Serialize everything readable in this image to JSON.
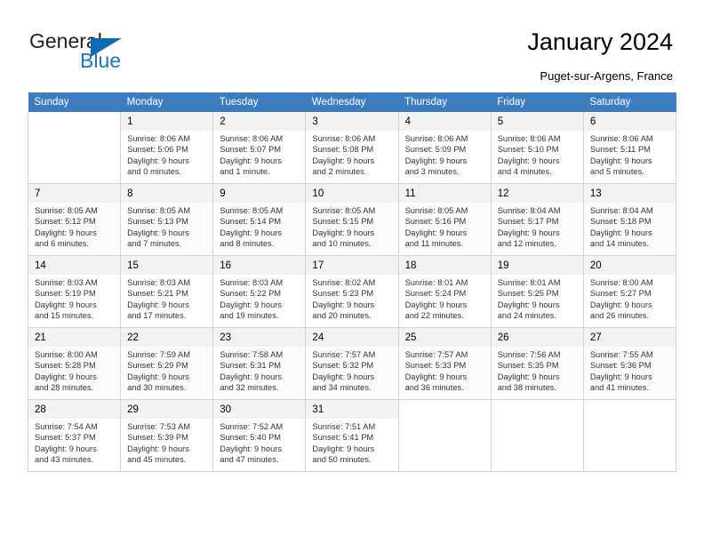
{
  "brand": {
    "name_top": "General",
    "name_bottom": "Blue",
    "accent_color": "#1b75bb",
    "triangle_color": "#0d6cb3"
  },
  "header": {
    "title": "January 2024",
    "subtitle": "Puget-sur-Argens, France"
  },
  "calendar": {
    "header_bg": "#3c7dc0",
    "header_text_color": "#ffffff",
    "weekdays": [
      "Sunday",
      "Monday",
      "Tuesday",
      "Wednesday",
      "Thursday",
      "Friday",
      "Saturday"
    ],
    "weeks": [
      [
        {
          "day": "",
          "sunrise": "",
          "sunset": "",
          "daylight_line1": "",
          "daylight_line2": ""
        },
        {
          "day": "1",
          "sunrise": "Sunrise: 8:06 AM",
          "sunset": "Sunset: 5:06 PM",
          "daylight_line1": "Daylight: 9 hours",
          "daylight_line2": "and 0 minutes."
        },
        {
          "day": "2",
          "sunrise": "Sunrise: 8:06 AM",
          "sunset": "Sunset: 5:07 PM",
          "daylight_line1": "Daylight: 9 hours",
          "daylight_line2": "and 1 minute."
        },
        {
          "day": "3",
          "sunrise": "Sunrise: 8:06 AM",
          "sunset": "Sunset: 5:08 PM",
          "daylight_line1": "Daylight: 9 hours",
          "daylight_line2": "and 2 minutes."
        },
        {
          "day": "4",
          "sunrise": "Sunrise: 8:06 AM",
          "sunset": "Sunset: 5:09 PM",
          "daylight_line1": "Daylight: 9 hours",
          "daylight_line2": "and 3 minutes."
        },
        {
          "day": "5",
          "sunrise": "Sunrise: 8:06 AM",
          "sunset": "Sunset: 5:10 PM",
          "daylight_line1": "Daylight: 9 hours",
          "daylight_line2": "and 4 minutes."
        },
        {
          "day": "6",
          "sunrise": "Sunrise: 8:06 AM",
          "sunset": "Sunset: 5:11 PM",
          "daylight_line1": "Daylight: 9 hours",
          "daylight_line2": "and 5 minutes."
        }
      ],
      [
        {
          "day": "7",
          "sunrise": "Sunrise: 8:05 AM",
          "sunset": "Sunset: 5:12 PM",
          "daylight_line1": "Daylight: 9 hours",
          "daylight_line2": "and 6 minutes."
        },
        {
          "day": "8",
          "sunrise": "Sunrise: 8:05 AM",
          "sunset": "Sunset: 5:13 PM",
          "daylight_line1": "Daylight: 9 hours",
          "daylight_line2": "and 7 minutes."
        },
        {
          "day": "9",
          "sunrise": "Sunrise: 8:05 AM",
          "sunset": "Sunset: 5:14 PM",
          "daylight_line1": "Daylight: 9 hours",
          "daylight_line2": "and 8 minutes."
        },
        {
          "day": "10",
          "sunrise": "Sunrise: 8:05 AM",
          "sunset": "Sunset: 5:15 PM",
          "daylight_line1": "Daylight: 9 hours",
          "daylight_line2": "and 10 minutes."
        },
        {
          "day": "11",
          "sunrise": "Sunrise: 8:05 AM",
          "sunset": "Sunset: 5:16 PM",
          "daylight_line1": "Daylight: 9 hours",
          "daylight_line2": "and 11 minutes."
        },
        {
          "day": "12",
          "sunrise": "Sunrise: 8:04 AM",
          "sunset": "Sunset: 5:17 PM",
          "daylight_line1": "Daylight: 9 hours",
          "daylight_line2": "and 12 minutes."
        },
        {
          "day": "13",
          "sunrise": "Sunrise: 8:04 AM",
          "sunset": "Sunset: 5:18 PM",
          "daylight_line1": "Daylight: 9 hours",
          "daylight_line2": "and 14 minutes."
        }
      ],
      [
        {
          "day": "14",
          "sunrise": "Sunrise: 8:03 AM",
          "sunset": "Sunset: 5:19 PM",
          "daylight_line1": "Daylight: 9 hours",
          "daylight_line2": "and 15 minutes."
        },
        {
          "day": "15",
          "sunrise": "Sunrise: 8:03 AM",
          "sunset": "Sunset: 5:21 PM",
          "daylight_line1": "Daylight: 9 hours",
          "daylight_line2": "and 17 minutes."
        },
        {
          "day": "16",
          "sunrise": "Sunrise: 8:03 AM",
          "sunset": "Sunset: 5:22 PM",
          "daylight_line1": "Daylight: 9 hours",
          "daylight_line2": "and 19 minutes."
        },
        {
          "day": "17",
          "sunrise": "Sunrise: 8:02 AM",
          "sunset": "Sunset: 5:23 PM",
          "daylight_line1": "Daylight: 9 hours",
          "daylight_line2": "and 20 minutes."
        },
        {
          "day": "18",
          "sunrise": "Sunrise: 8:01 AM",
          "sunset": "Sunset: 5:24 PM",
          "daylight_line1": "Daylight: 9 hours",
          "daylight_line2": "and 22 minutes."
        },
        {
          "day": "19",
          "sunrise": "Sunrise: 8:01 AM",
          "sunset": "Sunset: 5:25 PM",
          "daylight_line1": "Daylight: 9 hours",
          "daylight_line2": "and 24 minutes."
        },
        {
          "day": "20",
          "sunrise": "Sunrise: 8:00 AM",
          "sunset": "Sunset: 5:27 PM",
          "daylight_line1": "Daylight: 9 hours",
          "daylight_line2": "and 26 minutes."
        }
      ],
      [
        {
          "day": "21",
          "sunrise": "Sunrise: 8:00 AM",
          "sunset": "Sunset: 5:28 PM",
          "daylight_line1": "Daylight: 9 hours",
          "daylight_line2": "and 28 minutes."
        },
        {
          "day": "22",
          "sunrise": "Sunrise: 7:59 AM",
          "sunset": "Sunset: 5:29 PM",
          "daylight_line1": "Daylight: 9 hours",
          "daylight_line2": "and 30 minutes."
        },
        {
          "day": "23",
          "sunrise": "Sunrise: 7:58 AM",
          "sunset": "Sunset: 5:31 PM",
          "daylight_line1": "Daylight: 9 hours",
          "daylight_line2": "and 32 minutes."
        },
        {
          "day": "24",
          "sunrise": "Sunrise: 7:57 AM",
          "sunset": "Sunset: 5:32 PM",
          "daylight_line1": "Daylight: 9 hours",
          "daylight_line2": "and 34 minutes."
        },
        {
          "day": "25",
          "sunrise": "Sunrise: 7:57 AM",
          "sunset": "Sunset: 5:33 PM",
          "daylight_line1": "Daylight: 9 hours",
          "daylight_line2": "and 36 minutes."
        },
        {
          "day": "26",
          "sunrise": "Sunrise: 7:56 AM",
          "sunset": "Sunset: 5:35 PM",
          "daylight_line1": "Daylight: 9 hours",
          "daylight_line2": "and 38 minutes."
        },
        {
          "day": "27",
          "sunrise": "Sunrise: 7:55 AM",
          "sunset": "Sunset: 5:36 PM",
          "daylight_line1": "Daylight: 9 hours",
          "daylight_line2": "and 41 minutes."
        }
      ],
      [
        {
          "day": "28",
          "sunrise": "Sunrise: 7:54 AM",
          "sunset": "Sunset: 5:37 PM",
          "daylight_line1": "Daylight: 9 hours",
          "daylight_line2": "and 43 minutes."
        },
        {
          "day": "29",
          "sunrise": "Sunrise: 7:53 AM",
          "sunset": "Sunset: 5:39 PM",
          "daylight_line1": "Daylight: 9 hours",
          "daylight_line2": "and 45 minutes."
        },
        {
          "day": "30",
          "sunrise": "Sunrise: 7:52 AM",
          "sunset": "Sunset: 5:40 PM",
          "daylight_line1": "Daylight: 9 hours",
          "daylight_line2": "and 47 minutes."
        },
        {
          "day": "31",
          "sunrise": "Sunrise: 7:51 AM",
          "sunset": "Sunset: 5:41 PM",
          "daylight_line1": "Daylight: 9 hours",
          "daylight_line2": "and 50 minutes."
        },
        {
          "day": "",
          "sunrise": "",
          "sunset": "",
          "daylight_line1": "",
          "daylight_line2": ""
        },
        {
          "day": "",
          "sunrise": "",
          "sunset": "",
          "daylight_line1": "",
          "daylight_line2": ""
        },
        {
          "day": "",
          "sunrise": "",
          "sunset": "",
          "daylight_line1": "",
          "daylight_line2": ""
        }
      ]
    ]
  }
}
